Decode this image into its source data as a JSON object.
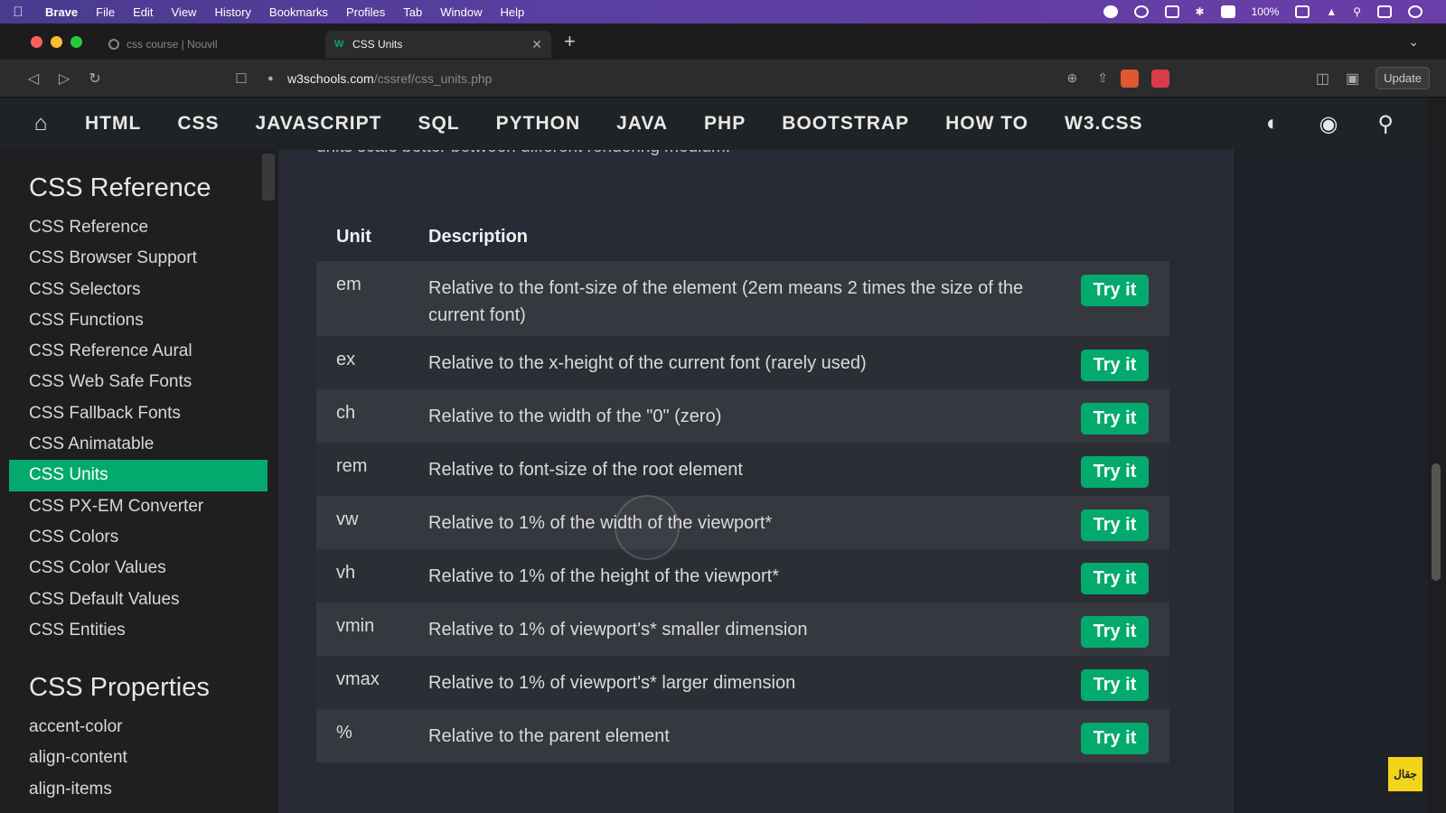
{
  "os_menu": {
    "app": "Brave",
    "items": [
      "File",
      "Edit",
      "View",
      "History",
      "Bookmarks",
      "Profiles",
      "Tab",
      "Window",
      "Help"
    ],
    "battery": "100%"
  },
  "browser": {
    "tabs": [
      {
        "label": "css course | Nouvil",
        "active": false
      },
      {
        "label": "CSS Units",
        "active": true
      }
    ],
    "url_host": "w3schools.com",
    "url_path": "/cssref/css_units.php",
    "update_label": "Update"
  },
  "topnav": {
    "links": [
      "HTML",
      "CSS",
      "JAVASCRIPT",
      "SQL",
      "PYTHON",
      "JAVA",
      "PHP",
      "BOOTSTRAP",
      "HOW TO",
      "W3.CSS"
    ]
  },
  "sidebar": {
    "heading": "CSS Reference",
    "items": [
      {
        "label": "CSS Reference",
        "active": false
      },
      {
        "label": "CSS Browser Support",
        "active": false
      },
      {
        "label": "CSS Selectors",
        "active": false
      },
      {
        "label": "CSS Functions",
        "active": false
      },
      {
        "label": "CSS Reference Aural",
        "active": false
      },
      {
        "label": "CSS Web Safe Fonts",
        "active": false
      },
      {
        "label": "CSS Fallback Fonts",
        "active": false
      },
      {
        "label": "CSS Animatable",
        "active": false
      },
      {
        "label": "CSS Units",
        "active": true
      },
      {
        "label": "CSS PX-EM Converter",
        "active": false
      },
      {
        "label": "CSS Colors",
        "active": false
      },
      {
        "label": "CSS Color Values",
        "active": false
      },
      {
        "label": "CSS Default Values",
        "active": false
      },
      {
        "label": "CSS Entities",
        "active": false
      }
    ],
    "heading2": "CSS Properties",
    "properties": [
      "accent-color",
      "align-content",
      "align-items"
    ]
  },
  "main": {
    "intro": "units scale better between different rendering medium.",
    "table": {
      "headers": [
        "Unit",
        "Description"
      ],
      "try_label": "Try it",
      "rows": [
        {
          "unit": "em",
          "desc": "Relative to the font-size of the element (2em means 2 times the size of the current font)"
        },
        {
          "unit": "ex",
          "desc": "Relative to the x-height of the current font (rarely used)"
        },
        {
          "unit": "ch",
          "desc": "Relative to the width of the \"0\" (zero)"
        },
        {
          "unit": "rem",
          "desc": "Relative to font-size of the root element"
        },
        {
          "unit": "vw",
          "desc": "Relative to 1% of the width of the viewport*"
        },
        {
          "unit": "vh",
          "desc": "Relative to 1% of the height of the viewport*"
        },
        {
          "unit": "vmin",
          "desc": "Relative to 1% of viewport's* smaller dimension"
        },
        {
          "unit": "vmax",
          "desc": "Relative to 1% of viewport's* larger dimension"
        },
        {
          "unit": "%",
          "desc": "Relative to the parent element"
        }
      ]
    }
  },
  "watermark": "جقال",
  "colors": {
    "accent": "#04aa6d",
    "nav_bg": "#202325",
    "main_bg": "#282a35",
    "sidebar_bg": "#1f1f21"
  }
}
